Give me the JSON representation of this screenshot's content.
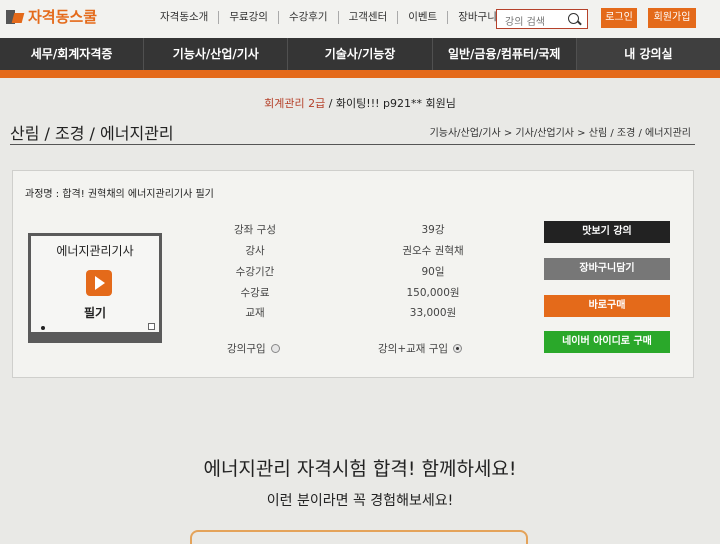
{
  "brand": {
    "name": "자격동스쿨"
  },
  "topnav": [
    "자격동소개",
    "무료강의",
    "수강후기",
    "고객센터",
    "이벤트",
    "장바구니"
  ],
  "search": {
    "placeholder": "강의 검색"
  },
  "auth": {
    "login": "로그인",
    "join": "회원가입"
  },
  "mainnav": [
    "세무/회계자격증",
    "기능사/산업/기사",
    "기술사/기능장",
    "일반/금융/컴퓨터/국제",
    "내 강의실"
  ],
  "greeting": {
    "rank": "회계관리 2급",
    "text": "/ 화이팅!!! p921** 회원님"
  },
  "page": {
    "title": "산림 / 조경 / 에너지관리",
    "breadcrumb": "기능사/산업/기사 > 기사/산업기사 > 산림 / 조경 / 에너지관리"
  },
  "course": {
    "name": "과정명 : 합격! 권혁채의 에너지관리기사 필기",
    "thumb_title": "에너지관리기사",
    "thumb_sub": "필기",
    "info": [
      {
        "label": "강좌 구성",
        "value": "39강"
      },
      {
        "label": "강사",
        "value": "권오수 권혁채"
      },
      {
        "label": "수강기간",
        "value": "90일"
      },
      {
        "label": "수강료",
        "value": "150,000원"
      },
      {
        "label": "교재",
        "value": "33,000원"
      }
    ],
    "options": [
      {
        "label": "강의구입",
        "selected": false
      },
      {
        "label": "강의+교재 구입",
        "selected": true
      }
    ],
    "buttons": {
      "preview": "맛보기 강의",
      "cart": "장바구니담기",
      "buy": "바로구매",
      "naver": "네이버 아이디로 구매"
    }
  },
  "promo": {
    "headline": "에너지관리 자격시험 합격! 함께하세요!",
    "sub": "이런 분이라면 꼭 경험해보세요!"
  },
  "colors": {
    "accent": "#e46a1a",
    "nav": "#353535",
    "naver": "#2aa82a"
  }
}
